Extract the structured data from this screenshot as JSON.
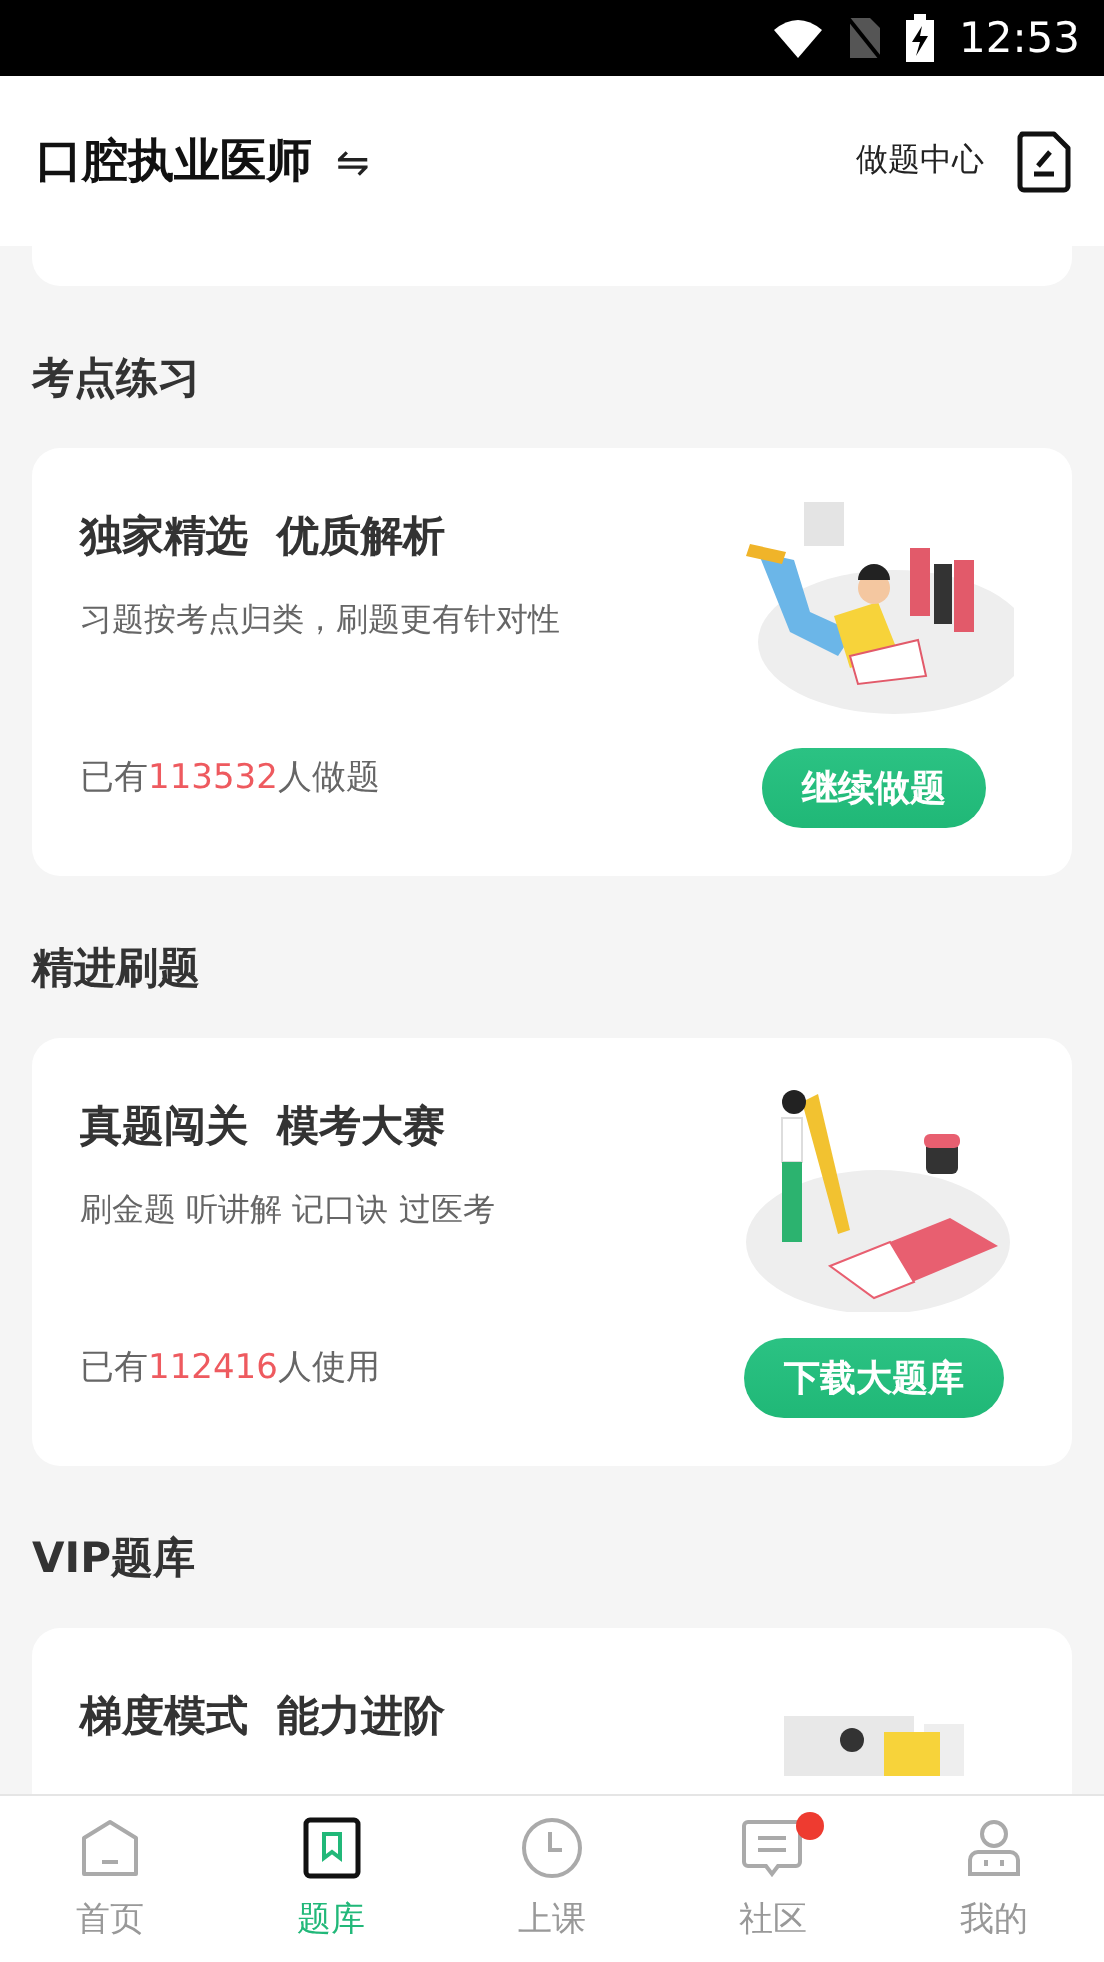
{
  "status_bar": {
    "time": "12:53"
  },
  "header": {
    "title": "口腔执业医师",
    "switch_icon": "⇋",
    "action": "做题中心"
  },
  "sections": [
    {
      "title": "考点练习",
      "card": {
        "headline": "独家精选  优质解析",
        "subtitle": "习题按考点归类，刷题更有针对性",
        "count_prefix": "已有",
        "count": "113532",
        "count_suffix": "人做题",
        "button": "继续做题",
        "kind": "reading"
      }
    },
    {
      "title": "精进刷题",
      "card": {
        "headline": "真题闯关  模考大赛",
        "subtitle": "刷金题 听讲解 记口诀 过医考",
        "count_prefix": "已有",
        "count": "112416",
        "count_suffix": "人使用",
        "button": "下载大题库",
        "kind": "writing"
      }
    },
    {
      "title": "VIP题库",
      "card": {
        "headline": "梯度模式  能力进阶",
        "kind": "folder"
      }
    }
  ],
  "tabs": [
    {
      "label": "首页",
      "kind": "home",
      "selected": false,
      "badge": false
    },
    {
      "label": "题库",
      "kind": "bank",
      "selected": true,
      "badge": false
    },
    {
      "label": "上课",
      "kind": "clock",
      "selected": false,
      "badge": false
    },
    {
      "label": "社区",
      "kind": "chat",
      "selected": false,
      "badge": true
    },
    {
      "label": "我的",
      "kind": "person",
      "selected": false,
      "badge": false
    }
  ]
}
